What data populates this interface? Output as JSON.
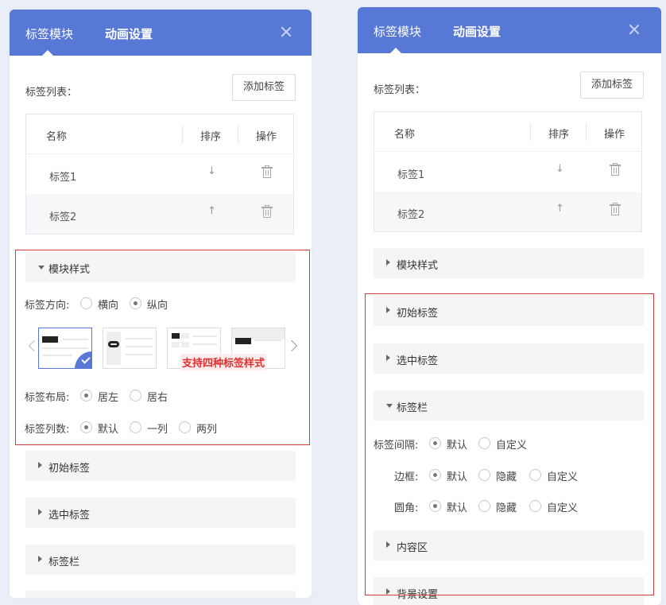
{
  "left": {
    "tabs": [
      {
        "label": "标签模块",
        "active": true
      },
      {
        "label": "动画设置",
        "active": false
      }
    ],
    "list_label": "标签列表：",
    "add_button": "添加标签",
    "table": {
      "headers": [
        "名称",
        "排序",
        "操作"
      ],
      "rows": [
        {
          "name": "标签1",
          "sort": "↓"
        },
        {
          "name": "标签2",
          "sort": "↑"
        }
      ]
    },
    "module_style": {
      "title": "模块样式",
      "direction": {
        "label": "标签方向:",
        "options": [
          "横向",
          "纵向"
        ],
        "selected": "纵向"
      },
      "styles_note": "支持四种标签样式",
      "layout": {
        "label": "标签布局:",
        "options": [
          "居左",
          "居右"
        ],
        "selected": "居左"
      },
      "columns": {
        "label": "标签列数:",
        "options": [
          "默认",
          "一列",
          "两列"
        ],
        "selected": "默认"
      }
    },
    "sections": [
      "初始标签",
      "选中标签",
      "标签栏"
    ]
  },
  "right": {
    "tabs": [
      {
        "label": "标签模块",
        "active": true
      },
      {
        "label": "动画设置",
        "active": false
      }
    ],
    "list_label": "标签列表：",
    "add_button": "添加标签",
    "table": {
      "headers": [
        "名称",
        "排序",
        "操作"
      ],
      "rows": [
        {
          "name": "标签1",
          "sort": "↓"
        },
        {
          "name": "标签2",
          "sort": "↑"
        }
      ]
    },
    "sections_top": [
      "模块样式",
      "初始标签",
      "选中标签"
    ],
    "tab_bar": {
      "title": "标签栏",
      "spacing": {
        "label": "标签间隔:",
        "options": [
          "默认",
          "自定义"
        ],
        "selected": "默认"
      },
      "border": {
        "label": "边框:",
        "options": [
          "默认",
          "隐藏",
          "自定义"
        ],
        "selected": "默认"
      },
      "radius": {
        "label": "圆角:",
        "options": [
          "默认",
          "隐藏",
          "自定义"
        ],
        "selected": "默认"
      }
    },
    "sections_bottom": [
      "内容区",
      "背景设置"
    ]
  },
  "colors": {
    "header": "#5878d6",
    "highlight_border": "#d43b3b",
    "note_text": "#e03030"
  }
}
